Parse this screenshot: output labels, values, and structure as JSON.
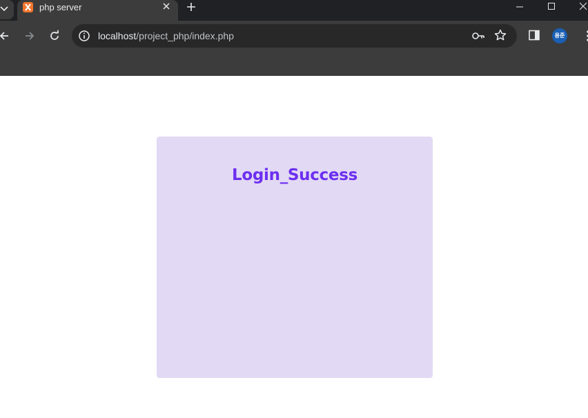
{
  "browser": {
    "tab": {
      "title": "php server",
      "favicon": "xampp-icon"
    },
    "address_bar": {
      "host": "localhost",
      "path": "/project_php/index.php"
    },
    "profile_avatar": "용준",
    "colors": {
      "tabstrip": "#202124",
      "toolbar": "#3c3c3c",
      "omnibox": "#282828",
      "favicon": "#f2752d",
      "avatar": "#1a5fb4"
    }
  },
  "page": {
    "heading": "Login_Success",
    "colors": {
      "card": "#e2d9f4",
      "heading": "#6c2ff0",
      "background": "#ffffff"
    }
  }
}
